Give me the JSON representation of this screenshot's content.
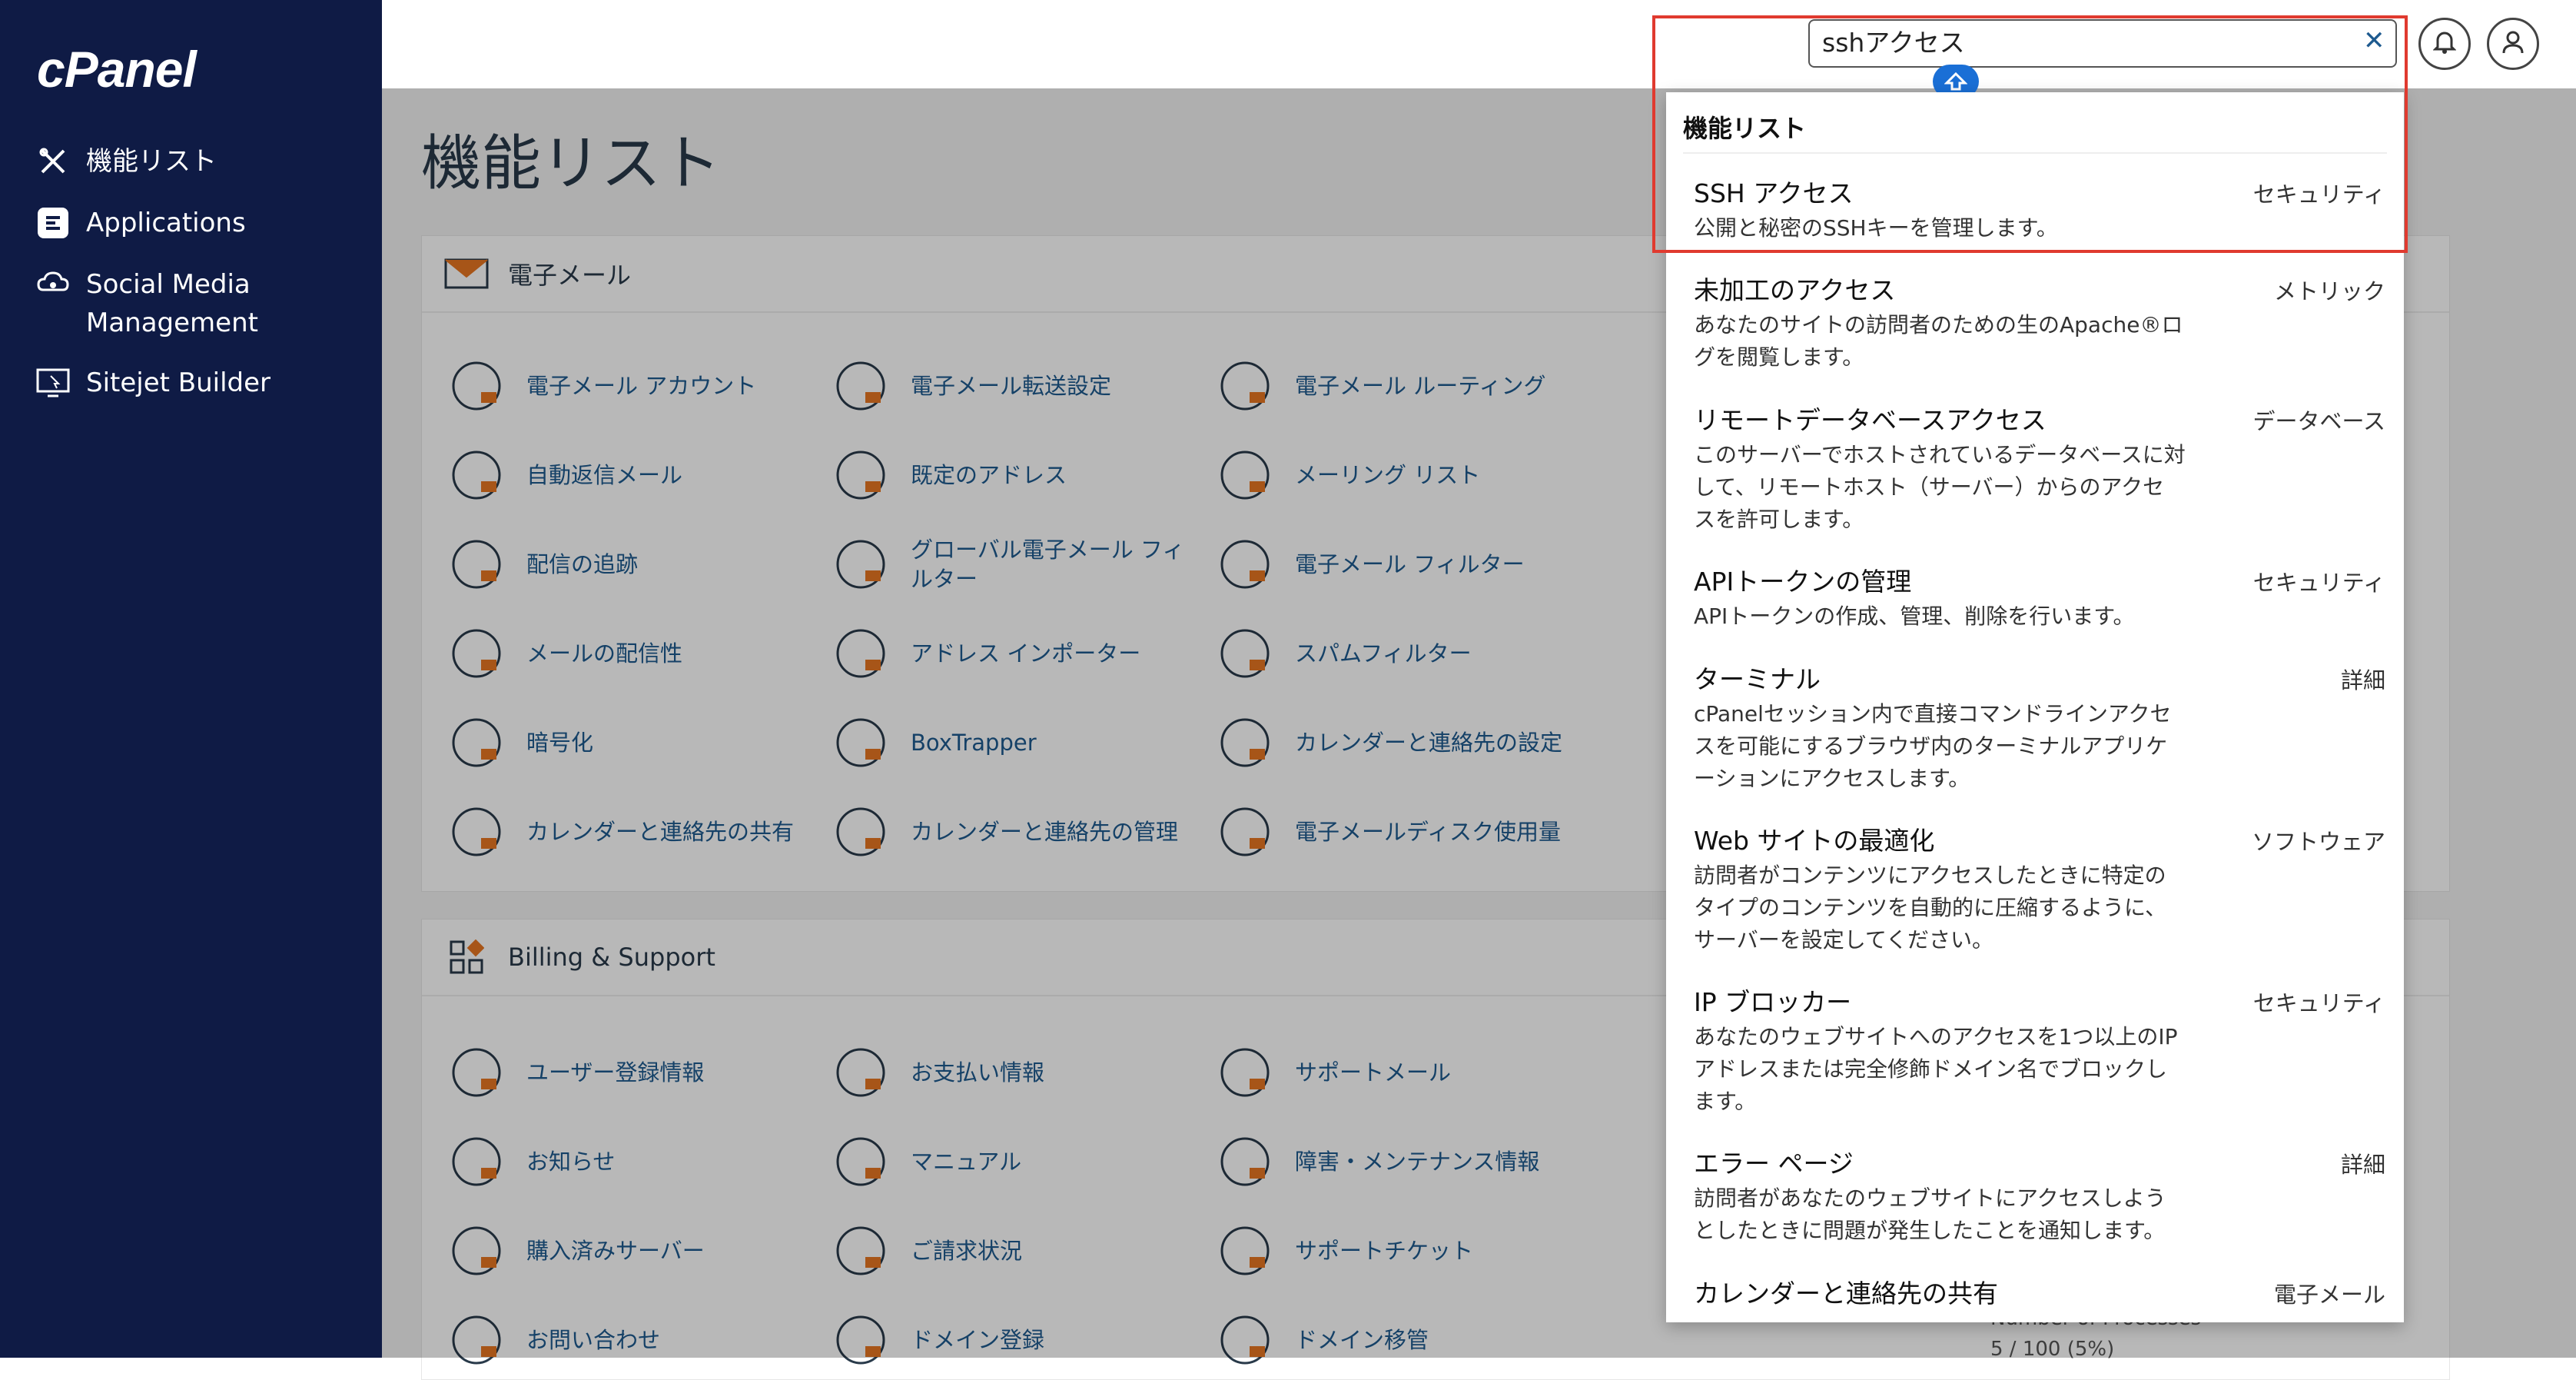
{
  "brand": {
    "logo_text": "cPanel"
  },
  "sidebar": {
    "items": [
      {
        "label": "機能リスト",
        "icon": "tools-icon"
      },
      {
        "label": "Applications",
        "icon": "applications-icon"
      },
      {
        "label": "Social Media\nManagement",
        "icon": "social-media-icon"
      },
      {
        "label": "Sitejet Builder",
        "icon": "sitejet-icon"
      }
    ]
  },
  "header": {
    "search_value": "sshアクセス",
    "clear_icon": "✕"
  },
  "main": {
    "page_title": "機能リスト",
    "email_section": {
      "title": "電子メール",
      "items": [
        "電子メール アカウント",
        "電子メール転送設定",
        "電子メール ルーティング",
        "自動返信メール",
        "既定のアドレス",
        "メーリング リスト",
        "配信の追跡",
        "グローバル電子メール フィルター",
        "電子メール フィルター",
        "メールの配信性",
        "アドレス インポーター",
        "スパムフィルター",
        "暗号化",
        "BoxTrapper",
        "カレンダーと連絡先の設定",
        "カレンダーと連絡先の共有",
        "カレンダーと連絡先の管理",
        "電子メールディスク使用量"
      ]
    },
    "billing_section": {
      "title": "Billing & Support",
      "items": [
        "ユーザー登録情報",
        "お支払い情報",
        "サポートメール",
        "お知らせ",
        "マニュアル",
        "障害・メンテナンス情報",
        "購入済みサーバー",
        "ご請求状況",
        "サポートチケット",
        "お問い合わせ",
        "ドメイン登録",
        "ドメイン移管"
      ]
    },
    "bg_stat_text": "Number of Processes",
    "bg_stat_value": "5 / 100   (5%)"
  },
  "dropdown": {
    "heading": "機能リスト",
    "results": [
      {
        "title": "SSH アクセス",
        "category": "セキュリティ",
        "desc": "公開と秘密のSSHキーを管理します。"
      },
      {
        "title": "未加工のアクセス",
        "category": "メトリック",
        "desc": "あなたのサイトの訪問者のための生のApache®ログを閲覧します。"
      },
      {
        "title": "リモートデータベースアクセス",
        "category": "データベース",
        "desc": "このサーバーでホストされているデータベースに対して、リモートホスト（サーバー）からのアクセスを許可します。"
      },
      {
        "title": "APIトークンの管理",
        "category": "セキュリティ",
        "desc": "APIトークンの作成、管理、削除を行います。"
      },
      {
        "title": "ターミナル",
        "category": "詳細",
        "desc": "cPanelセッション内で直接コマンドラインアクセスを可能にするブラウザ内のターミナルアプリケーションにアクセスします。"
      },
      {
        "title": "Web サイトの最適化",
        "category": "ソフトウェア",
        "desc": "訪問者がコンテンツにアクセスしたときに特定のタイプのコンテンツを自動的に圧縮するように、サーバーを設定してください。"
      },
      {
        "title": "IP ブロッカー",
        "category": "セキュリティ",
        "desc": "あなたのウェブサイトへのアクセスを1つ以上のIPアドレスまたは完全修飾ドメイン名でブロックします。"
      },
      {
        "title": "エラー ページ",
        "category": "詳細",
        "desc": "訪問者があなたのウェブサイトにアクセスしようとしたときに問題が発生したことを通知します。"
      },
      {
        "title": "カレンダーと連絡先の共有",
        "category": "電子メール",
        "desc": ""
      }
    ]
  },
  "colors": {
    "sidebar": "#0f1b45",
    "link": "#1e5a8f",
    "accent": "#e87722",
    "highlight": "#e03a2f"
  }
}
